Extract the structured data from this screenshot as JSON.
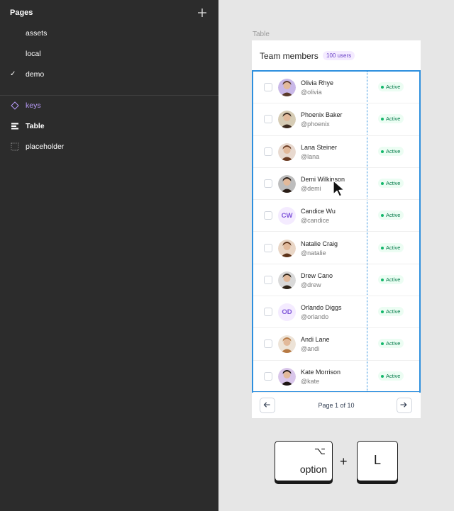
{
  "sidebar": {
    "pages_title": "Pages",
    "pages": [
      {
        "label": "assets",
        "selected": false
      },
      {
        "label": "local",
        "selected": false
      },
      {
        "label": "demo",
        "selected": true
      }
    ],
    "current_page_check": "✓",
    "layers": [
      {
        "label": "keys",
        "icon": "component-icon"
      },
      {
        "label": "Table",
        "icon": "text-align-icon"
      },
      {
        "label": "placeholder",
        "icon": "frame-dashed-icon"
      }
    ]
  },
  "canvas": {
    "frame_label": "Table",
    "card": {
      "title": "Team members",
      "badge": "100 users"
    },
    "members": [
      {
        "name": "Olivia Rhye",
        "handle": "@olivia",
        "status": "Active",
        "initials": ""
      },
      {
        "name": "Phoenix Baker",
        "handle": "@phoenix",
        "status": "Active",
        "initials": ""
      },
      {
        "name": "Lana Steiner",
        "handle": "@lana",
        "status": "Active",
        "initials": ""
      },
      {
        "name": "Demi Wilkinson",
        "handle": "@demi",
        "status": "Active",
        "initials": ""
      },
      {
        "name": "Candice Wu",
        "handle": "@candice",
        "status": "Active",
        "initials": "CW"
      },
      {
        "name": "Natalie Craig",
        "handle": "@natalie",
        "status": "Active",
        "initials": ""
      },
      {
        "name": "Drew Cano",
        "handle": "@drew",
        "status": "Active",
        "initials": ""
      },
      {
        "name": "Orlando Diggs",
        "handle": "@orlando",
        "status": "Active",
        "initials": "OD"
      },
      {
        "name": "Andi Lane",
        "handle": "@andi",
        "status": "Active",
        "initials": ""
      },
      {
        "name": "Kate Morrison",
        "handle": "@kate",
        "status": "Active",
        "initials": ""
      }
    ],
    "pagination": {
      "text": "Page 1 of 10"
    }
  },
  "shortcut": {
    "modifier_symbol": "⌥",
    "modifier_label": "option",
    "plus": "+",
    "key": "L"
  },
  "colors": {
    "panel_bg": "#2c2c2c",
    "canvas_bg": "#e6e6e6",
    "selection": "#2d8fde",
    "component_purple": "#b79af7",
    "status_green": "#12b76a"
  }
}
